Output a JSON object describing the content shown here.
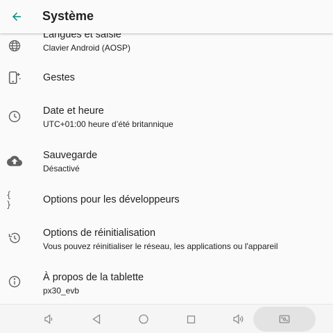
{
  "header": {
    "back_icon": "arrow-back-icon",
    "title": "Système",
    "accent_color": "#00897b"
  },
  "settings": [
    {
      "icon": "globe-icon",
      "label": "Langues et saisie",
      "summary": "Clavier Android (AOSP)"
    },
    {
      "icon": "gestures-icon",
      "label": "Gestes",
      "summary": ""
    },
    {
      "icon": "clock-icon",
      "label": "Date et heure",
      "summary": "UTC+01:00 heure d’été britannique"
    },
    {
      "icon": "cloud-upload-icon",
      "label": "Sauvegarde",
      "summary": "Désactivé"
    },
    {
      "icon": "braces-icon",
      "label": "Options pour les développeurs",
      "summary": ""
    },
    {
      "icon": "history-icon",
      "label": "Options de réinitialisation",
      "summary": "Vous pouvez réinitialiser le réseau, les applications ou l'appareil"
    },
    {
      "icon": "info-icon",
      "label": "À propos de la tablette",
      "summary": "px30_evb"
    }
  ],
  "navbar": {
    "icons": [
      "volume-down-icon",
      "back-icon",
      "home-icon",
      "recents-icon",
      "volume-up-icon",
      "screenshot-icon"
    ]
  }
}
